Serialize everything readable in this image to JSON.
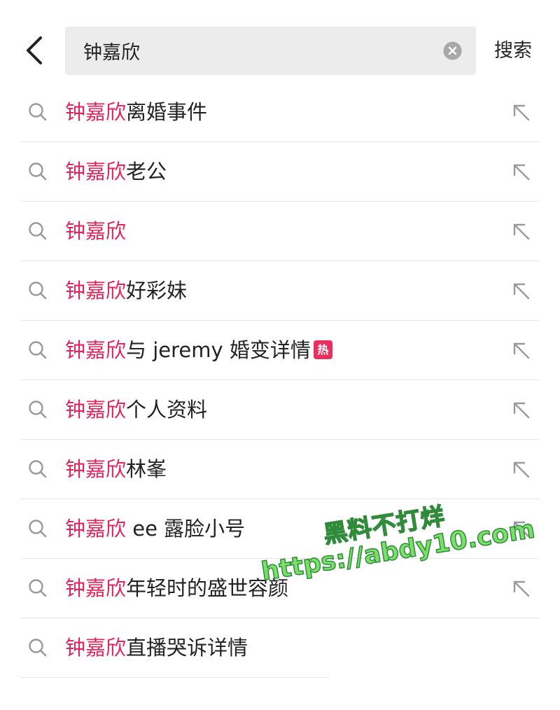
{
  "header": {
    "back_icon": "chevron-left-icon",
    "search_value": "钟嘉欣",
    "clear_icon": "clear-circle-icon",
    "submit_label": "搜索"
  },
  "suggestions": [
    {
      "highlight": "钟嘉欣",
      "rest": "离婚事件",
      "badge": "",
      "fill_icon": "arrow-up-left-icon"
    },
    {
      "highlight": "钟嘉欣",
      "rest": "老公",
      "badge": "",
      "fill_icon": "arrow-up-left-icon"
    },
    {
      "highlight": "钟嘉欣",
      "rest": "",
      "badge": "",
      "fill_icon": "arrow-up-left-icon"
    },
    {
      "highlight": "钟嘉欣",
      "rest": "好彩妹",
      "badge": "",
      "fill_icon": "arrow-up-left-icon"
    },
    {
      "highlight": "钟嘉欣",
      "rest": "与 jeremy 婚变详情",
      "badge": "热",
      "fill_icon": "arrow-up-left-icon"
    },
    {
      "highlight": "钟嘉欣",
      "rest": "个人资料",
      "badge": "",
      "fill_icon": "arrow-up-left-icon"
    },
    {
      "highlight": "钟嘉欣",
      "rest": "林峯",
      "badge": "",
      "fill_icon": "arrow-up-left-icon"
    },
    {
      "highlight": "钟嘉欣",
      "rest": " ee 露脸小号",
      "badge": "",
      "fill_icon": "arrow-up-left-icon"
    },
    {
      "highlight": "钟嘉欣",
      "rest": "年轻时的盛世容颜",
      "badge": "",
      "fill_icon": "arrow-up-left-icon"
    },
    {
      "highlight": "钟嘉欣",
      "rest": "直播哭诉详情",
      "badge": "",
      "fill_icon": ""
    }
  ],
  "watermark": {
    "line1": "黑料不打烊",
    "line2": "https://abdy10.com"
  },
  "colors": {
    "highlight": "#e2255a",
    "badge": "#e8305e",
    "search_bg": "#ececec",
    "divider": "#e6e6e6"
  }
}
